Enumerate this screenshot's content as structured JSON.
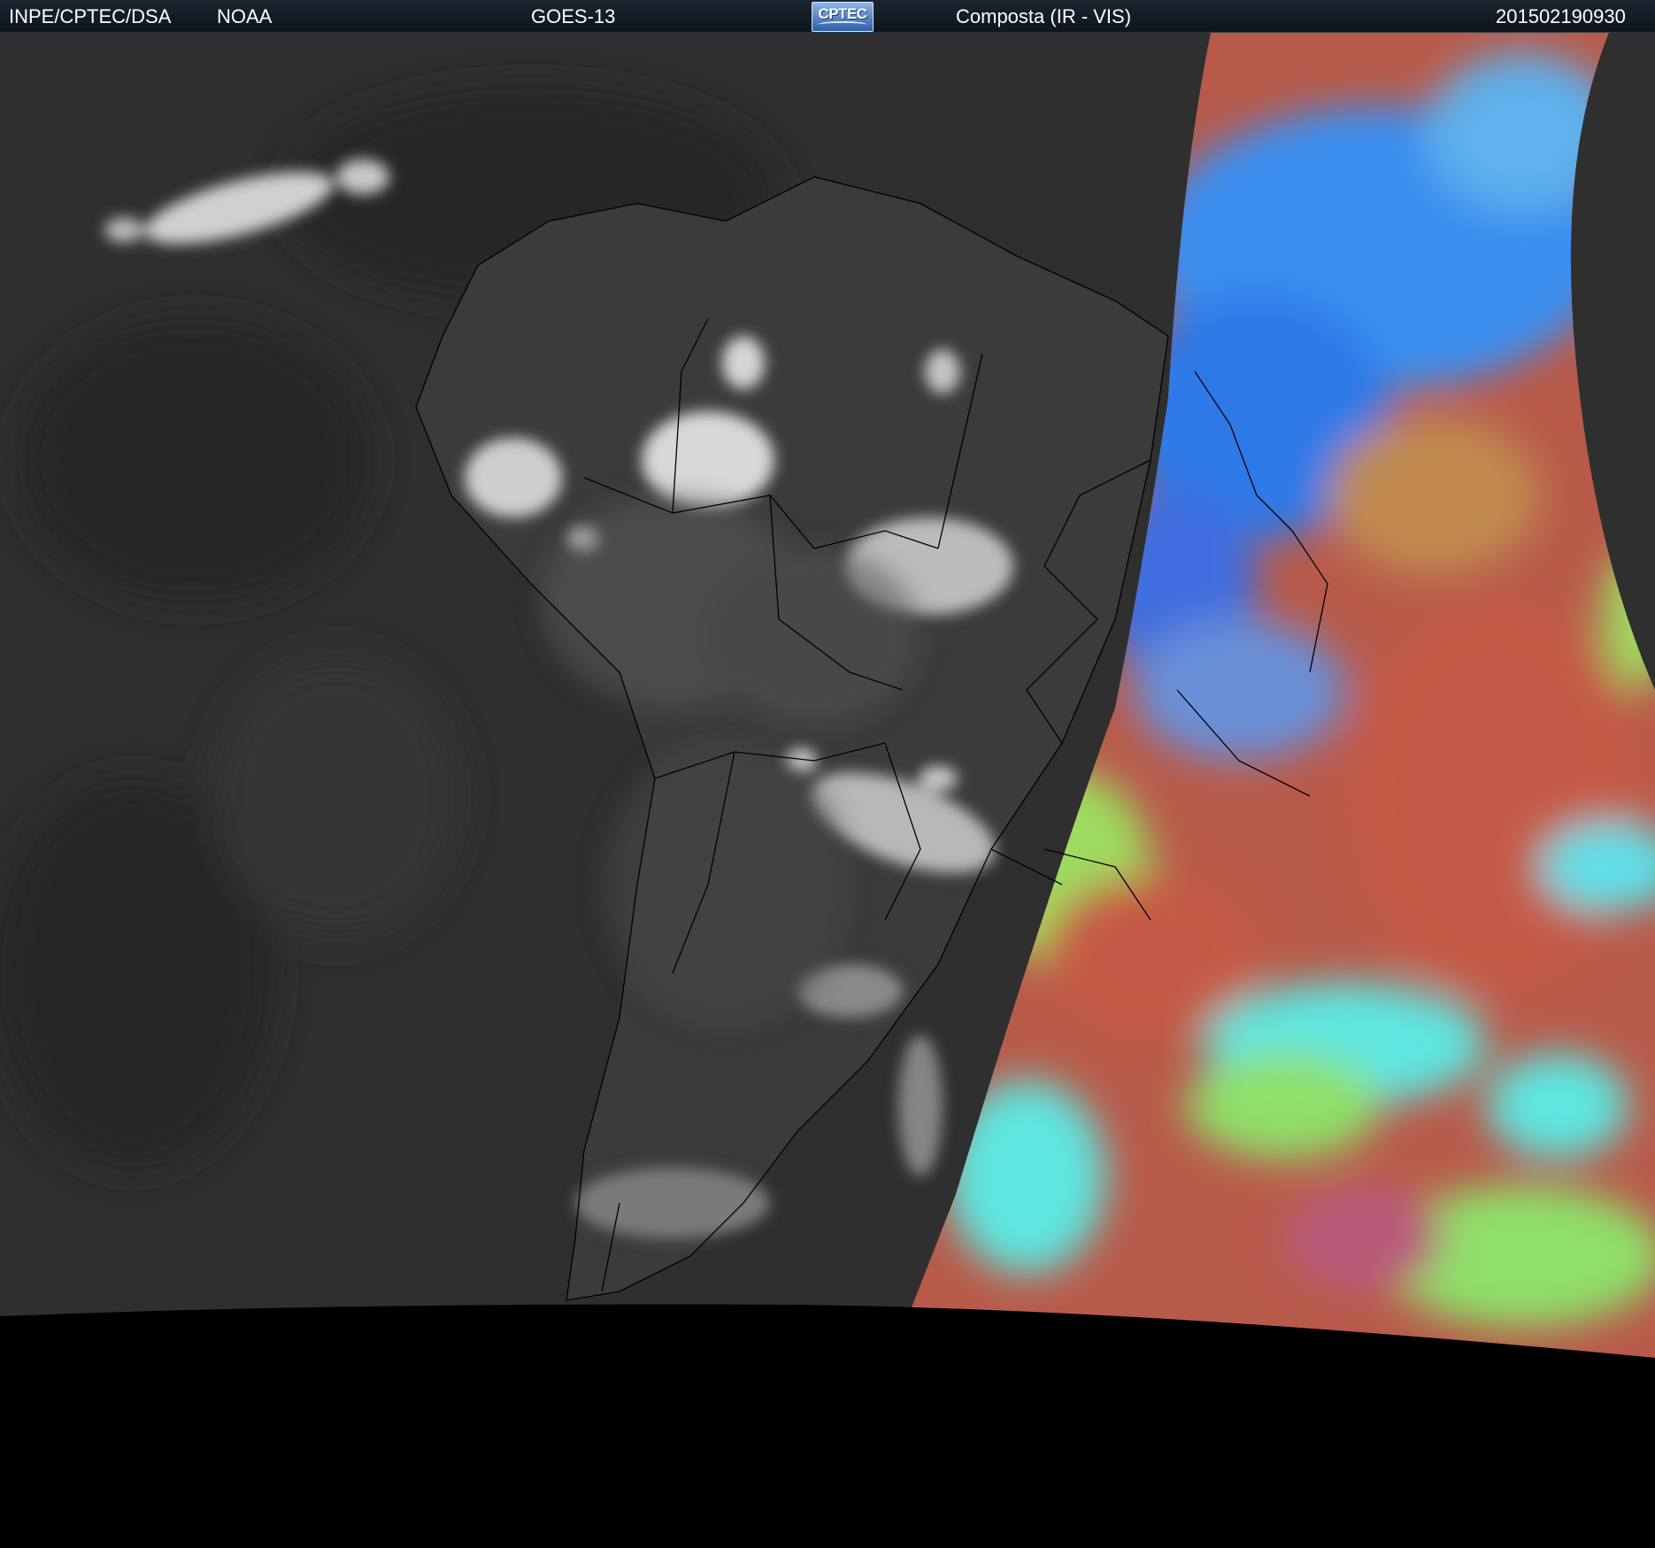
{
  "header": {
    "agency": "INPE/CPTEC/DSA",
    "provider": "NOAA",
    "satellite": "GOES-13",
    "logo_text": "CPTEC",
    "product": "Composta (IR - VIS)",
    "timestamp": "201502190930"
  },
  "map": {
    "region": "South America",
    "left_half": "infrared grayscale",
    "right_half": "visible false-color",
    "colors": {
      "ocean_ir": "#2f2f2f",
      "land_ir": "#3d3d3d",
      "cloud_ir": "#d8d8d8",
      "vis_red": "#b85a4a",
      "vis_blue": "#3a8ef0",
      "vis_cyan": "#5fe6e0",
      "vis_green": "#8fe06a",
      "border_line": "#000000",
      "space": "#000000"
    }
  }
}
